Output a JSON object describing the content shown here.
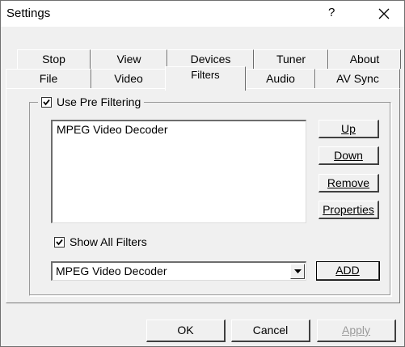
{
  "window": {
    "title": "Settings",
    "help_glyph": "?"
  },
  "tabs": {
    "row0": [
      "Stop",
      "View",
      "Devices",
      "Tuner",
      "About"
    ],
    "row1": [
      "File",
      "Video",
      "Filters",
      "Audio",
      "AV Sync"
    ],
    "active": "Filters"
  },
  "prefilter": {
    "label": "Use Pre Filtering",
    "checked": true,
    "list_items": [
      "MPEG Video Decoder"
    ],
    "buttons": {
      "up": "Up",
      "down": "Down",
      "remove": "Remove",
      "properties": "Properties"
    },
    "show_all_label": "Show All Filters",
    "show_all_checked": true,
    "combo_value": "MPEG Video Decoder",
    "add_label": "ADD"
  },
  "footer": {
    "ok": "OK",
    "cancel": "Cancel",
    "apply": "Apply",
    "apply_enabled": false
  },
  "icons": {
    "close": "close-icon",
    "check": "check-icon",
    "dropdown": "chevron-down-icon"
  }
}
